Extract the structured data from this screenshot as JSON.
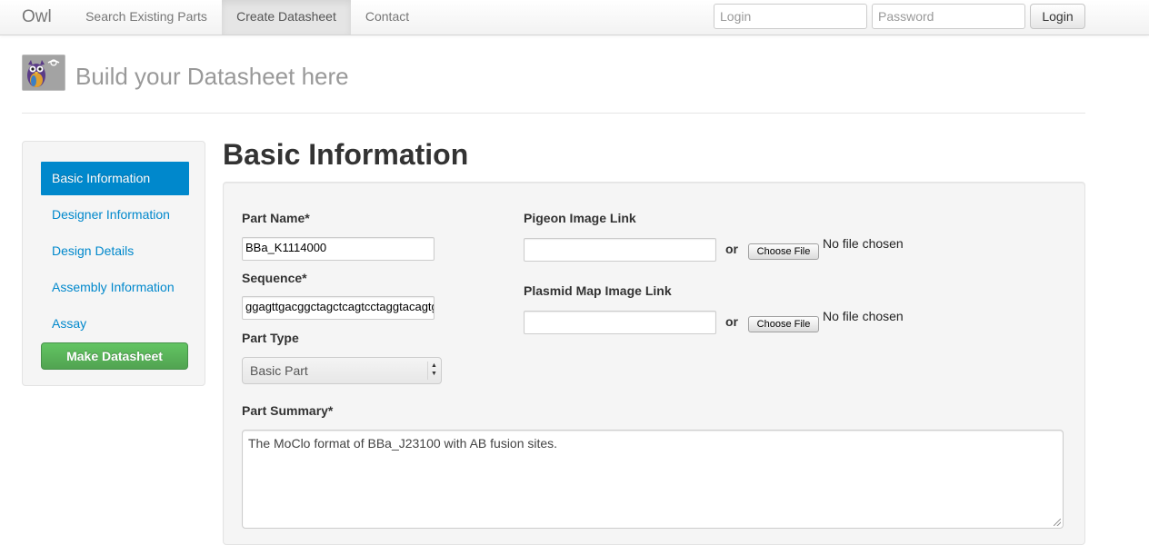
{
  "navbar": {
    "brand": "Owl",
    "links": [
      "Search Existing Parts",
      "Create Datasheet",
      "Contact"
    ],
    "login_placeholder": "Login",
    "password_placeholder": "Password",
    "login_button": "Login"
  },
  "header": {
    "logo_icon": "owl-logo-icon",
    "title": "Build your Datasheet here"
  },
  "sidebar": {
    "items": [
      "Basic Information",
      "Designer Information",
      "Design Details",
      "Assembly Information",
      "Assay"
    ],
    "active_index": 0,
    "make_button": "Make Datasheet"
  },
  "main": {
    "title": "Basic Information",
    "part_name": {
      "label": "Part Name*",
      "value": "BBa_K1114000"
    },
    "sequence": {
      "label": "Sequence*",
      "value": "ggagttgacggctagctcagtcctaggtacagtgctagc"
    },
    "part_type": {
      "label": "Part Type",
      "value": "Basic Part"
    },
    "pigeon": {
      "label": "Pigeon Image Link",
      "value": "",
      "or": "or",
      "choose_file": "Choose File",
      "file_status": "No file chosen"
    },
    "plasmid": {
      "label": "Plasmid Map Image Link",
      "value": "",
      "or": "or",
      "choose_file": "Choose File",
      "file_status": "No file chosen"
    },
    "summary": {
      "label": "Part Summary*",
      "value": "The MoClo format of BBa_J23100 with AB fusion sites."
    }
  },
  "colors": {
    "link": "#0088cc",
    "active_nav": "#0088cc",
    "success": "#5bb75b"
  }
}
